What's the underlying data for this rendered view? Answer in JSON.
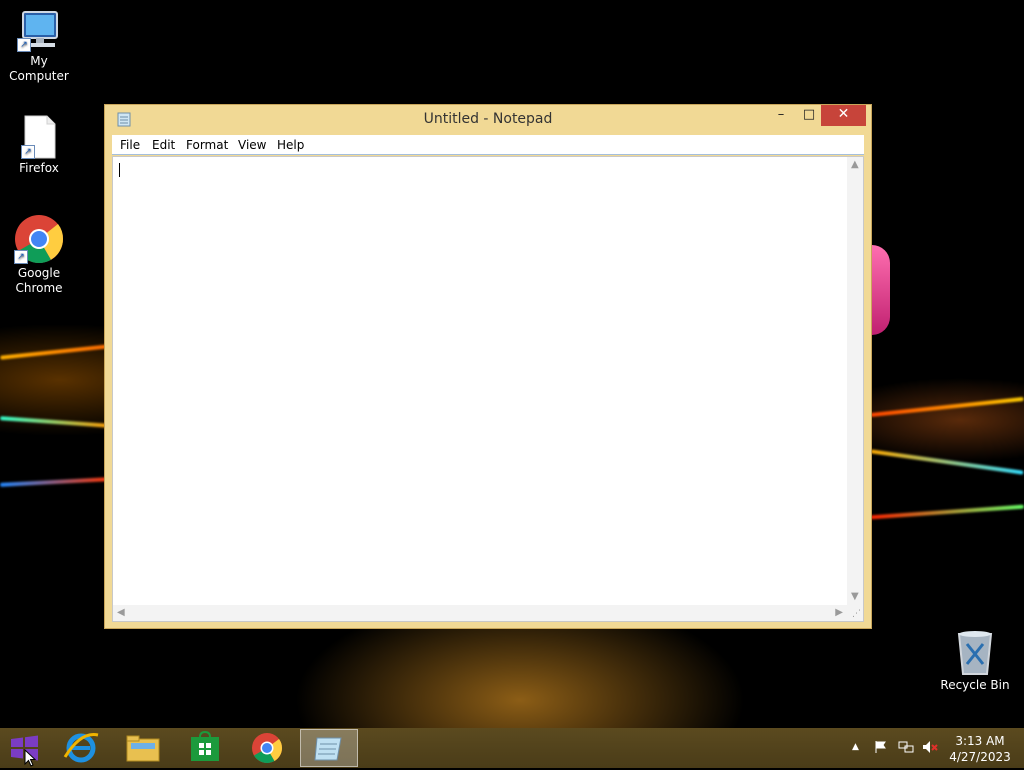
{
  "desktop": {
    "icons": [
      {
        "label": "My Computer"
      },
      {
        "label": "Firefox"
      },
      {
        "label": "Google Chrome"
      },
      {
        "label": "Recycle Bin"
      }
    ]
  },
  "notepad": {
    "title": "Untitled - Notepad",
    "menu": [
      "File",
      "Edit",
      "Format",
      "View",
      "Help"
    ],
    "content": "",
    "buttons": {
      "minimize": "–",
      "maximize": "□",
      "close": "✕"
    }
  },
  "taskbar": {
    "items": [
      "start-button",
      "internet-explorer",
      "file-explorer",
      "store",
      "google-chrome",
      "notepad"
    ],
    "active": "notepad",
    "tray_icons": [
      "show-hidden-icons",
      "action-center-flag",
      "network",
      "volume-muted"
    ],
    "clock": {
      "time": "3:13 AM",
      "date": "4/27/2023"
    }
  },
  "colors": {
    "window_frame": "#f1d995",
    "close_button": "#c7443a",
    "taskbar": "#4f401b",
    "desktop_bg": "#000000"
  }
}
